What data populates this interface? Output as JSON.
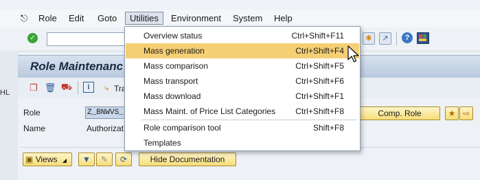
{
  "menubar": {
    "items": [
      {
        "label": "Role"
      },
      {
        "label": "Edit"
      },
      {
        "label": "Goto"
      },
      {
        "label": "Utilities"
      },
      {
        "label": "Environment"
      },
      {
        "label": "System"
      },
      {
        "label": "Help"
      }
    ]
  },
  "screen": {
    "title": "Role Maintenanc",
    "transport_label": "Tra"
  },
  "form": {
    "role_label": "Role",
    "role_value": "Z_BNWVS_",
    "name_label": "Name",
    "name_value": "Authorizat"
  },
  "buttons": {
    "comp_role": "Comp. Role",
    "views": "Views",
    "hide_documentation": "Hide Documentation"
  },
  "utilities_menu": {
    "items": [
      {
        "label": "Overview status",
        "shortcut": "Ctrl+Shift+F11",
        "highlighted": false
      },
      {
        "label": "Mass generation",
        "shortcut": "Ctrl+Shift+F4",
        "highlighted": true
      },
      {
        "label": "Mass comparison",
        "shortcut": "Ctrl+Shift+F5",
        "highlighted": false
      },
      {
        "label": "Mass transport",
        "shortcut": "Ctrl+Shift+F6",
        "highlighted": false
      },
      {
        "label": "Mass download",
        "shortcut": "Ctrl+Shift+F1",
        "highlighted": false
      },
      {
        "label": "Mass Maint. of Price List Categories",
        "shortcut": "Ctrl+Shift+F8",
        "highlighted": false
      },
      {
        "label": "Role comparison tool",
        "shortcut": "Shift+F8",
        "highlighted": false
      },
      {
        "label": "Templates",
        "shortcut": "",
        "highlighted": false
      }
    ]
  },
  "side_fragment": "HL",
  "colors": {
    "menu_highlight": "#f5cf74",
    "title_bar": "#c8d6e7",
    "button_yellow": "#f6dd7a"
  }
}
